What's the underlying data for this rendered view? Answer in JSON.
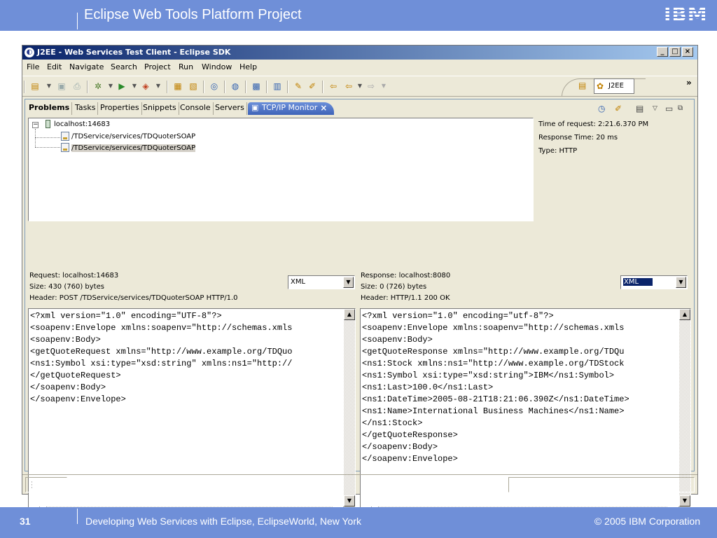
{
  "slide": {
    "header_title": "Eclipse Web Tools Platform Project",
    "logo_text": "IBM",
    "page_number": "31",
    "footer_text": "Developing Web Services with Eclipse, EclipseWorld, New York",
    "copyright": "© 2005 IBM Corporation"
  },
  "window": {
    "title": "J2EE - Web Services Test Client - Eclipse SDK",
    "controls": {
      "minimize": "_",
      "maximize": "□",
      "close": "×"
    }
  },
  "menu": [
    "File",
    "Edit",
    "Navigate",
    "Search",
    "Project",
    "Run",
    "Window",
    "Help"
  ],
  "perspective": {
    "label": "J2EE",
    "overflow": "»"
  },
  "tabs": [
    "Problems",
    "Tasks",
    "Properties",
    "Snippets",
    "Console",
    "Servers",
    "TCP/IP Monitor"
  ],
  "tree": {
    "root": "localhost:14683",
    "toggle": "−",
    "items": [
      "/TDService/services/TDQuoterSOAP",
      "/TDService/services/TDQuoterSOAP"
    ]
  },
  "info": {
    "time_of_request": "Time of request: 2:21.6.370 PM",
    "response_time": "Response Time: 20 ms",
    "type": "Type: HTTP"
  },
  "request": {
    "label": "Request: localhost:14683",
    "size": "Size: 430 (760) bytes",
    "header": "Header: POST /TDService/services/TDQuoterSOAP HTTP/1.0",
    "format": "XML",
    "body": "<?xml version=\"1.0\" encoding=\"UTF-8\"?>\n<soapenv:Envelope xmlns:soapenv=\"http://schemas.xmls\n<soapenv:Body>\n<getQuoteRequest xmlns=\"http://www.example.org/TDQuo\n<ns1:Symbol xsi:type=\"xsd:string\" xmlns:ns1=\"http://\n</getQuoteRequest>\n</soapenv:Body>\n</soapenv:Envelope>"
  },
  "response": {
    "label": "Response: localhost:8080",
    "size": "Size: 0 (726) bytes",
    "header": "Header: HTTP/1.1 200 OK",
    "format": "XML",
    "body": "<?xml version=\"1.0\" encoding=\"utf-8\"?>\n<soapenv:Envelope xmlns:soapenv=\"http://schemas.xmls\n<soapenv:Body>\n<getQuoteResponse xmlns=\"http://www.example.org/TDQu\n<ns1:Stock xmlns:ns1=\"http://www.example.org/TDStock\n<ns1:Symbol xsi:type=\"xsd:string\">IBM</ns1:Symbol>\n<ns1:Last>100.0</ns1:Last>\n<ns1:DateTime>2005-08-21T18:21:06.390Z</ns1:DateTime>\n<ns1:Name>International Business Machines</ns1:Name>\n</ns1:Stock>\n</getQuoteResponse>\n</soapenv:Body>\n</soapenv:Envelope>"
  },
  "icons": {
    "toolbar": [
      "new-wizard-icon",
      "save-icon",
      "print-icon",
      "debug-icon",
      "run-icon",
      "external-tools-icon",
      "new-project-icon",
      "new-server-icon",
      "web-services-icon",
      "open-type-icon",
      "search-icon",
      "open-browser-icon",
      "annotation-icon",
      "back-icon",
      "forward-icon"
    ],
    "view": [
      "start-monitor-icon",
      "clear-icon",
      "properties-icon",
      "view-menu-icon",
      "minimize-view-icon",
      "maximize-view-icon"
    ]
  },
  "colors": {
    "slide_blue": "#6f8fd8",
    "title_gradient_start": "#0a246a",
    "active_tab": "#3e63b8",
    "window_bg": "#ece9d8"
  }
}
